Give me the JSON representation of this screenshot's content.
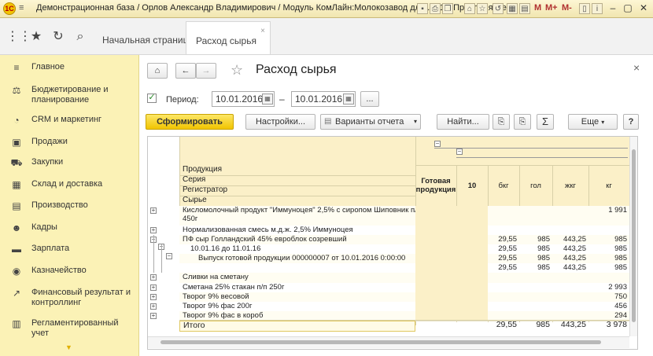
{
  "titlebar": {
    "title": "Демонстрационная база / Орлов Александр Владимирович / Модуль КомЛайн:Молокозавод для ... (1С:Предприятие)",
    "m_label": "M",
    "mplus_label": "M+",
    "mminus_label": "M-"
  },
  "tabs": [
    {
      "label": "Начальная страница"
    },
    {
      "label": "Расход сырья",
      "close": "×"
    }
  ],
  "sidebar": {
    "items": [
      {
        "label": "Главное",
        "icon": "menu-lines-icon"
      },
      {
        "label": "Бюджетирование и планирование",
        "icon": "budget-icon"
      },
      {
        "label": "CRM и маркетинг",
        "icon": "pie-chart-icon"
      },
      {
        "label": "Продажи",
        "icon": "bag-icon"
      },
      {
        "label": "Закупки",
        "icon": "truck-icon"
      },
      {
        "label": "Склад и доставка",
        "icon": "warehouse-icon"
      },
      {
        "label": "Производство",
        "icon": "factory-icon"
      },
      {
        "label": "Кадры",
        "icon": "people-icon"
      },
      {
        "label": "Зарплата",
        "icon": "wallet-icon"
      },
      {
        "label": "Казначейство",
        "icon": "coin-icon"
      },
      {
        "label": "Финансовый результат и контроллинг",
        "icon": "chart-icon"
      },
      {
        "label": "Регламентированный учет",
        "icon": "ledger-icon"
      }
    ]
  },
  "form": {
    "title": "Расход сырья",
    "period_label": "Период:",
    "date_from": "10.01.2016",
    "date_to": "10.01.2016",
    "dash": "–",
    "dots": "...",
    "generate": "Сформировать",
    "settings": "Настройки...",
    "variants": "Варианты отчета",
    "find": "Найти...",
    "more": "Еще",
    "help": "?",
    "sum_icon": "Σ"
  },
  "report": {
    "row_headers": [
      "Продукция",
      "Серия",
      "Регистратор",
      "Сырье"
    ],
    "col_headers": [
      "Готовая продукция",
      "10",
      "бкг",
      "гол",
      "жкг",
      "кг"
    ],
    "rows": [
      {
        "label": "Кисломолочный продукт \"Иммуноцея\" 2,5% с сиропом Шиповник п/п",
        "label2": "450г",
        "v": [
          "",
          "",
          "",
          "",
          "",
          "1 991"
        ]
      },
      {
        "label": "Нормализованная смесь м.д.ж. 2,5% Иммуноцея",
        "v": [
          "",
          "",
          "",
          "",
          "",
          ""
        ]
      },
      {
        "label": "ПФ сыр Голландский 45% евроблок созревший",
        "v": [
          "",
          "",
          "29,55",
          "985",
          "443,25",
          "985"
        ]
      },
      {
        "label": "10.01.16 до 11.01.16",
        "v": [
          "",
          "",
          "29,55",
          "985",
          "443,25",
          "985"
        ]
      },
      {
        "label": "Выпуск готовой продукции 000000007 от 10.01.2016 0:00:00",
        "v": [
          "",
          "",
          "29,55",
          "985",
          "443,25",
          "985"
        ]
      },
      {
        "label": "",
        "v": [
          "",
          "",
          "29,55",
          "985",
          "443,25",
          "985"
        ]
      },
      {
        "label": "Сливки на сметану",
        "v": [
          "",
          "",
          "",
          "",
          "",
          ""
        ]
      },
      {
        "label": "Сметана 25% стакан п/п 250г",
        "v": [
          "",
          "",
          "",
          "",
          "",
          "2 993"
        ]
      },
      {
        "label": "Творог 9% весовой",
        "v": [
          "",
          "",
          "",
          "",
          "",
          "750"
        ]
      },
      {
        "label": "Творог 9% фас 200г",
        "v": [
          "",
          "",
          "",
          "",
          "",
          "456"
        ]
      },
      {
        "label": "Творог 9% фас в короб",
        "v": [
          "",
          "",
          "",
          "",
          "",
          "294"
        ]
      }
    ],
    "total": {
      "label": "Итого",
      "v": [
        "",
        "",
        "29,55",
        "985",
        "443,25",
        "3 978"
      ]
    }
  }
}
